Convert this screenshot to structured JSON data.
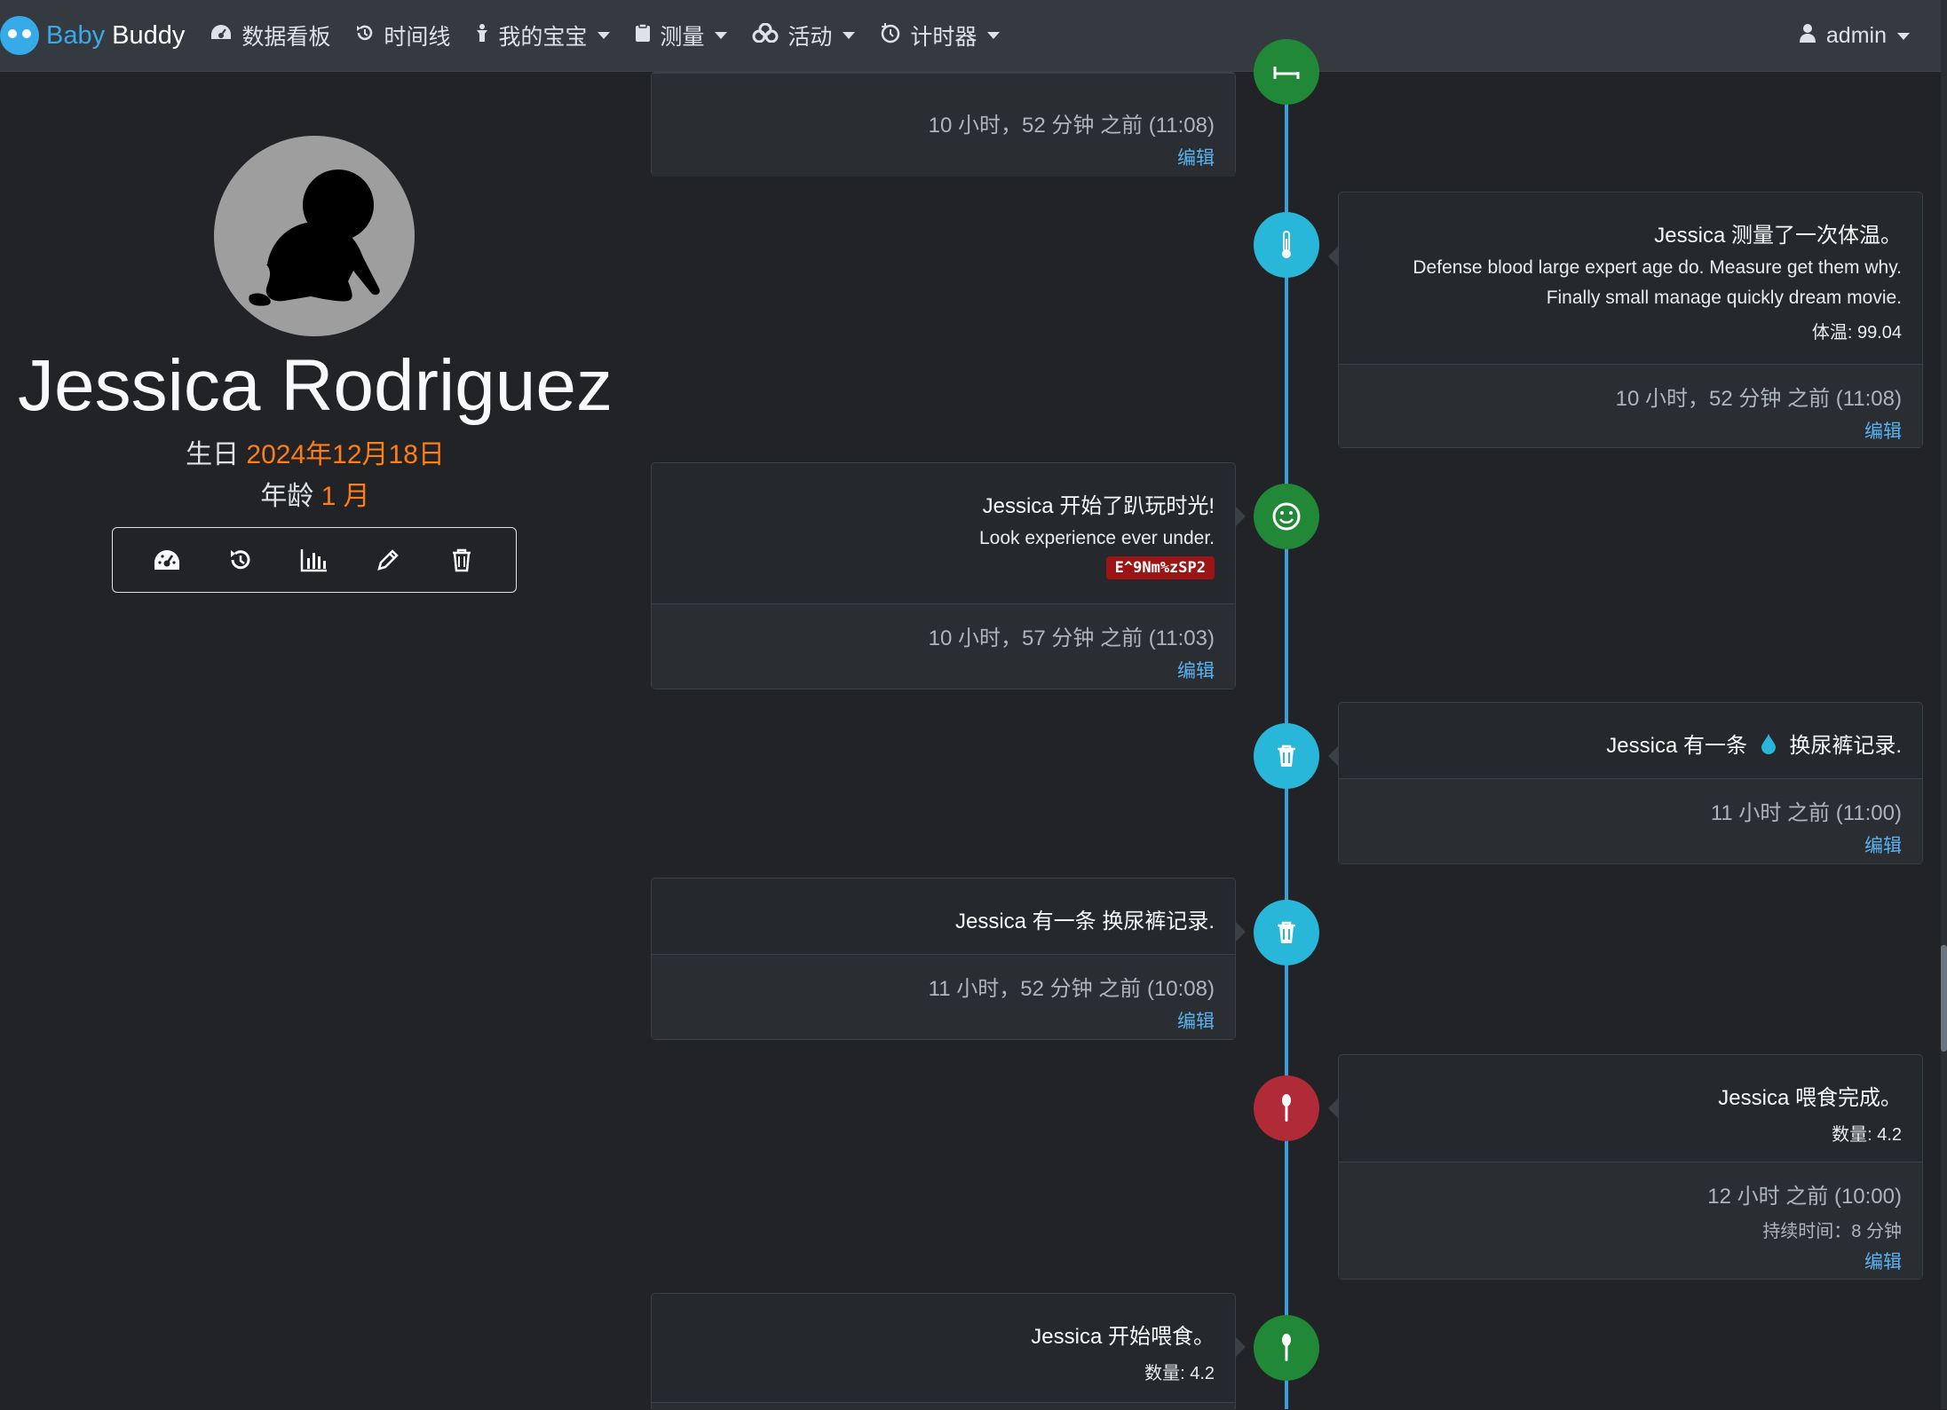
{
  "nav": {
    "brand_part1": "Baby",
    "brand_part2": "Buddy",
    "items": [
      {
        "label": "数据看板",
        "icon": "dashboard-icon"
      },
      {
        "label": "时间线",
        "icon": "history-icon"
      },
      {
        "label": "我的宝宝",
        "icon": "baby-icon"
      },
      {
        "label": "测量",
        "icon": "clipboard-icon"
      },
      {
        "label": "活动",
        "icon": "activities-icon"
      },
      {
        "label": "计时器",
        "icon": "timer-icon"
      }
    ],
    "user": "admin"
  },
  "profile": {
    "name": "Jessica Rodriguez",
    "birthday_label": "生日",
    "birthday_value": "2024年12月18日",
    "age_label": "年龄",
    "age_value": "1 月"
  },
  "timeline": {
    "edit_label": "编辑",
    "entries": [
      {
        "time": "10 小时，52 分钟 之前 (11:08)"
      },
      {
        "title": "Jessica 测量了一次体温。",
        "line1": "Defense blood large expert age do. Measure get them why.",
        "line2": "Finally small manage quickly dream movie.",
        "detail": "体温: 99.04",
        "time": "10 小时，52 分钟 之前 (11:08)"
      },
      {
        "title": "Jessica 开始了趴玩时光!",
        "line1": "Look experience ever under.",
        "badge": "E^9Nm%zSP2",
        "time": "10 小时，57 分钟 之前 (11:03)"
      },
      {
        "title_pre": "Jessica 有一条",
        "title_post": "换尿裤记录.",
        "time": "11 小时 之前 (11:00)"
      },
      {
        "title": "Jessica 有一条 换尿裤记录.",
        "time": "11 小时，52 分钟 之前 (10:08)"
      },
      {
        "title": "Jessica 喂食完成。",
        "detail": "数量: 4.2",
        "time": "12 小时 之前 (10:00)",
        "duration": "持续时间：8 分钟"
      },
      {
        "title": "Jessica 开始喂食。",
        "detail": "数量: 4.2"
      }
    ]
  },
  "colors": {
    "accent": "#37abe9",
    "highlight": "#fd7e14",
    "green": "#218838",
    "cyan": "#28b7d9",
    "red": "#b02a37",
    "badge": "#9c1414"
  }
}
